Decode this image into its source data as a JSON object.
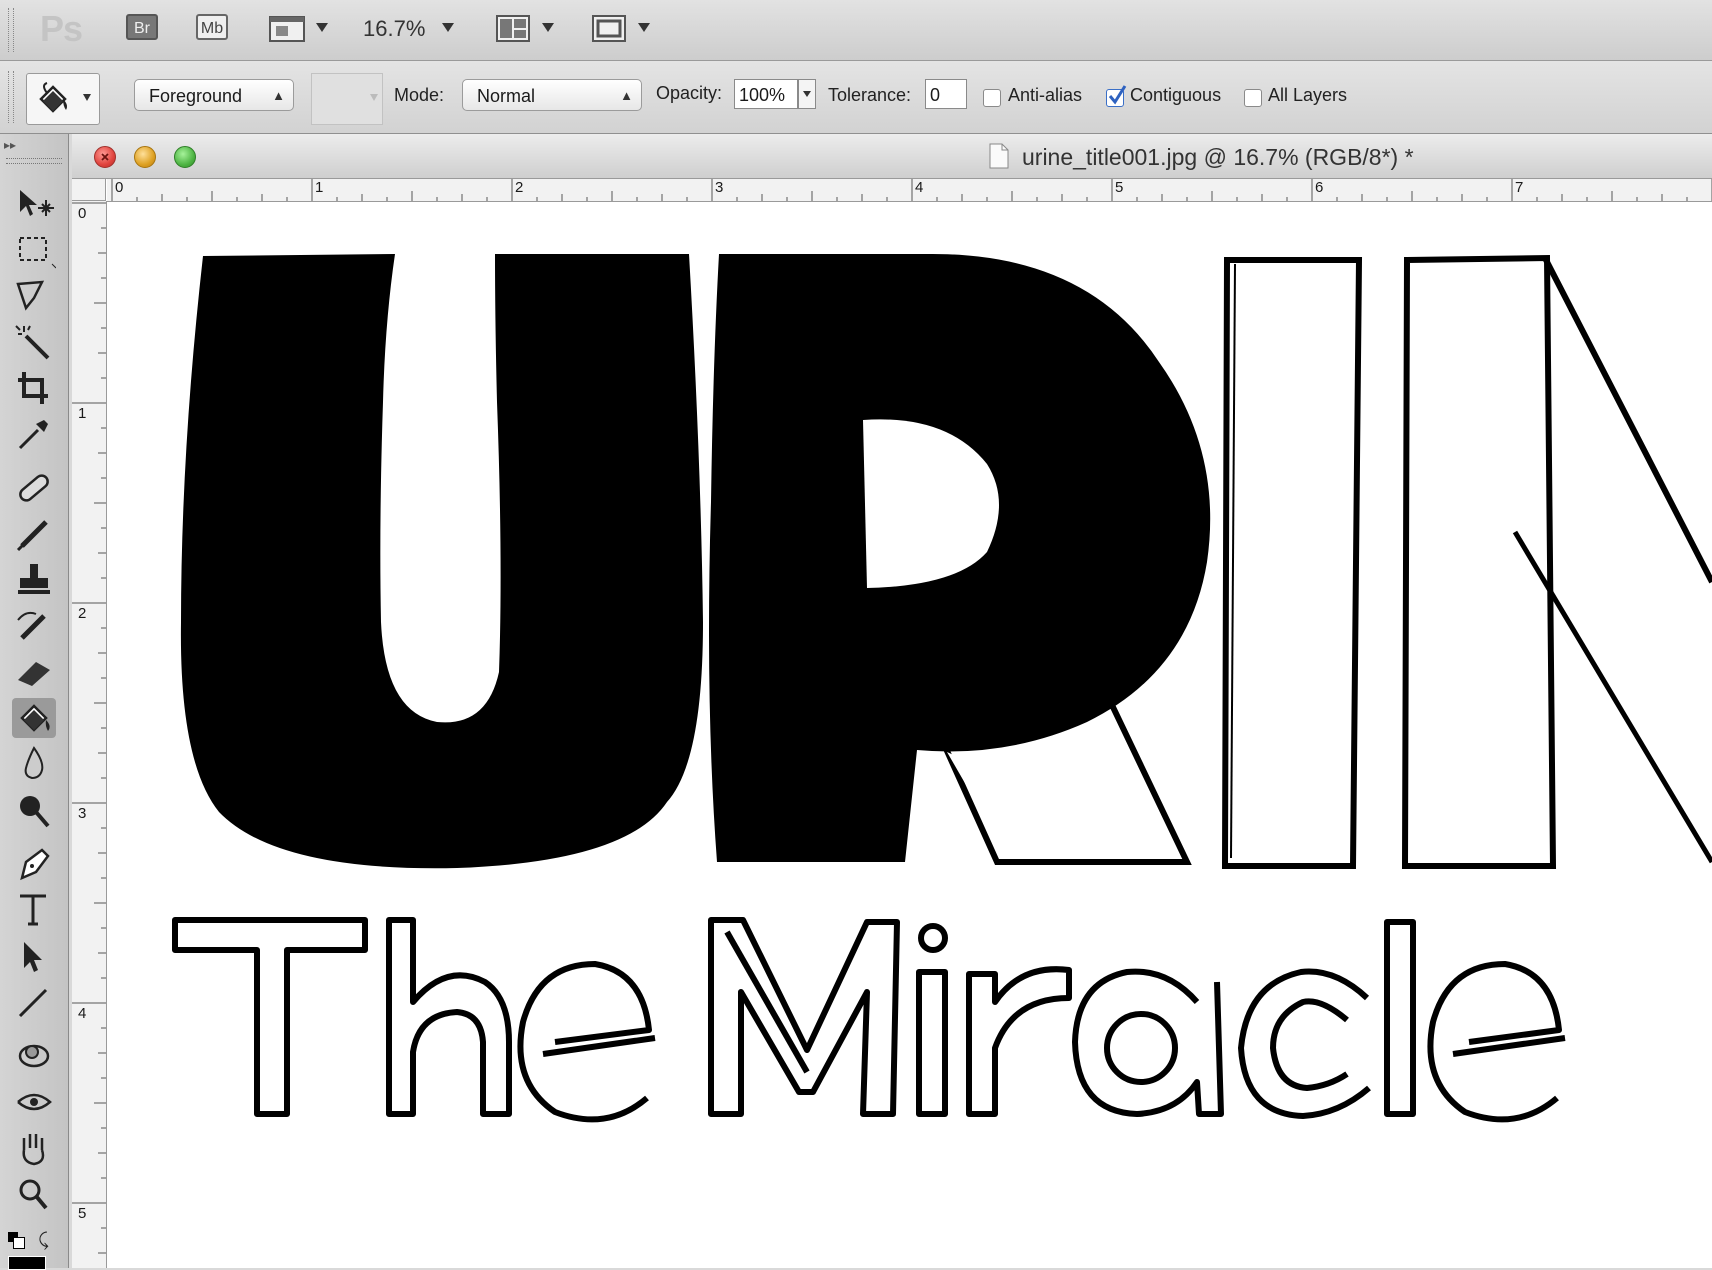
{
  "app_bar": {
    "logo": "Ps",
    "bridge_button": "Br",
    "minibridge_button": "Mb",
    "zoom_level": "16.7%"
  },
  "options_bar": {
    "fill_source": "Foreground",
    "mode_label": "Mode:",
    "mode_value": "Normal",
    "opacity_label": "Opacity:",
    "opacity_value": "100%",
    "tolerance_label": "Tolerance:",
    "tolerance_value": "0",
    "anti_alias_label": "Anti-alias",
    "anti_alias_checked": false,
    "contiguous_label": "Contiguous",
    "contiguous_checked": true,
    "all_layers_label": "All Layers",
    "all_layers_checked": false
  },
  "document": {
    "title": "urine_title001.jpg @ 16.7% (RGB/8*) *",
    "horizontal_ruler_labels": [
      "0",
      "1",
      "2",
      "3",
      "4",
      "5",
      "6",
      "7"
    ],
    "vertical_ruler_labels": [
      "0",
      "1",
      "2",
      "3",
      "4",
      "5"
    ],
    "canvas_text_main": "URIN",
    "canvas_text_sub": "The Miracle"
  },
  "toolbox": {
    "tools": [
      "move-tool",
      "marquee-tool",
      "lasso-tool",
      "magic-wand-tool",
      "crop-tool",
      "eyedropper-tool",
      "healing-brush-tool",
      "brush-tool",
      "clone-stamp-tool",
      "history-brush-tool",
      "eraser-tool",
      "paint-bucket-tool",
      "blur-tool",
      "dodge-tool",
      "pen-tool",
      "type-tool",
      "path-selection-tool",
      "line-tool",
      "3d-rotate-tool",
      "3d-orbit-tool",
      "hand-tool",
      "zoom-tool"
    ],
    "active_tool": "paint-bucket-tool"
  },
  "colors": {
    "close": "#e0443e",
    "minimize": "#dea123",
    "zoom": "#4fb544",
    "checkbox_accent": "#3a6fc7"
  }
}
